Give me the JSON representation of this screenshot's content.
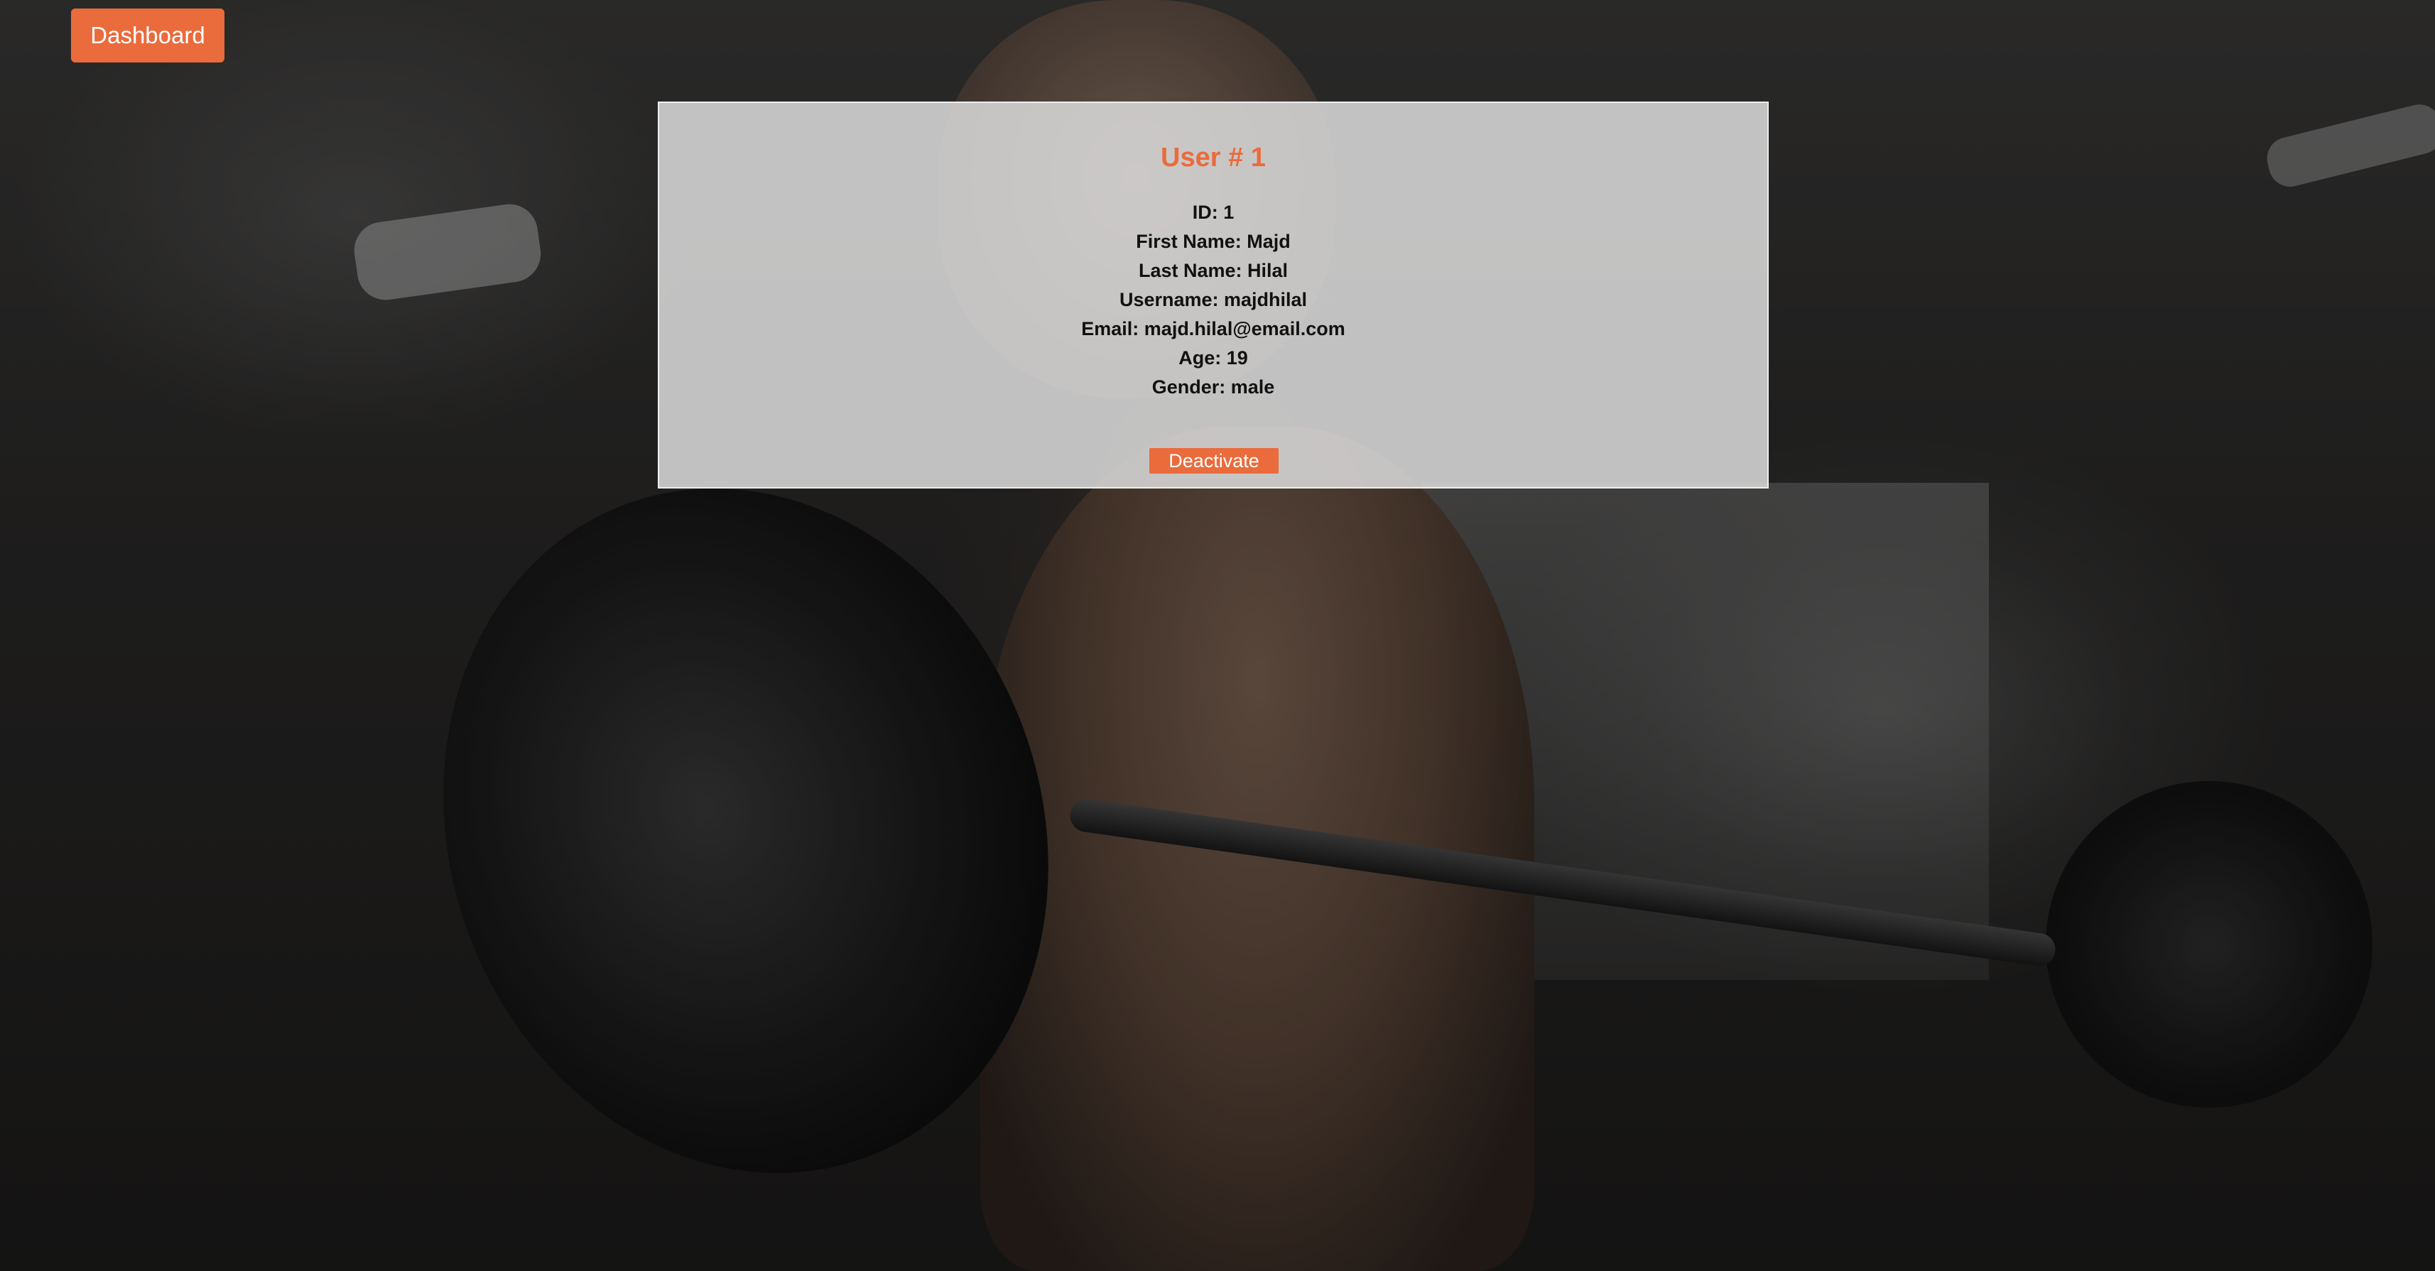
{
  "nav": {
    "dashboard_label": "Dashboard"
  },
  "user": {
    "title": "User # 1",
    "fields": [
      "ID: 1",
      "First Name: Majd",
      "Last Name: Hilal",
      "Username: majdhilal",
      "Email: majd.hilal@email.com",
      "Age: 19",
      "Gender: male"
    ],
    "deactivate_label": "Deactivate"
  },
  "colors": {
    "accent": "#ea6b3c",
    "card_background": "#dcdcdc",
    "text": "#111111"
  }
}
